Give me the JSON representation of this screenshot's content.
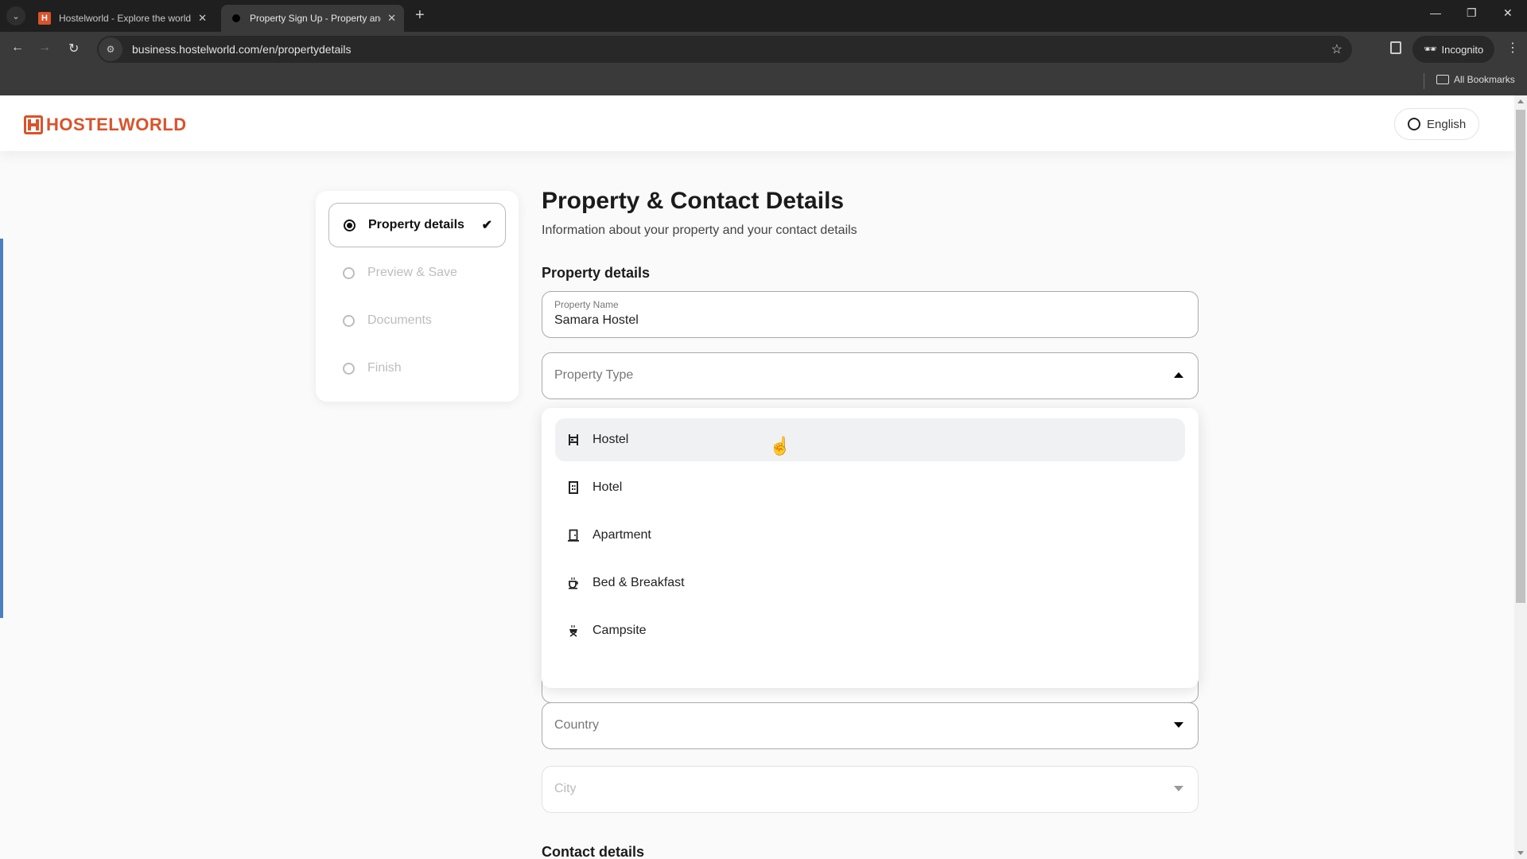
{
  "browser": {
    "tabs": [
      {
        "title": "Hostelworld - Explore the world",
        "active": false
      },
      {
        "title": "Property Sign Up - Property and",
        "active": true
      }
    ],
    "url": "business.hostelworld.com/en/propertydetails",
    "incognito_label": "Incognito",
    "bookmarks_label": "All Bookmarks"
  },
  "header": {
    "logo_text": "HOSTELWORLD",
    "language": "English"
  },
  "colors": {
    "brand": "#d9532b",
    "accent_bar": "#4a7fc1"
  },
  "steps": [
    {
      "label": "Property details",
      "active": true,
      "completed": true
    },
    {
      "label": "Preview & Save",
      "active": false,
      "completed": false
    },
    {
      "label": "Documents",
      "active": false,
      "completed": false
    },
    {
      "label": "Finish",
      "active": false,
      "completed": false
    }
  ],
  "main": {
    "title": "Property & Contact Details",
    "subtitle": "Information about your property and your contact details",
    "property_section": "Property details",
    "contact_section": "Contact details",
    "property_name": {
      "label": "Property Name",
      "value": "Samara Hostel"
    },
    "property_type": {
      "placeholder": "Property Type",
      "expanded": true
    },
    "country": {
      "placeholder": "Country"
    },
    "city": {
      "placeholder": "City",
      "disabled": true
    }
  },
  "property_type_options": [
    {
      "label": "Hostel",
      "icon": "bunk-bed-icon",
      "hovered": true
    },
    {
      "label": "Hotel",
      "icon": "building-icon",
      "hovered": false
    },
    {
      "label": "Apartment",
      "icon": "door-icon",
      "hovered": false
    },
    {
      "label": "Bed & Breakfast",
      "icon": "coffee-cup-icon",
      "hovered": false
    },
    {
      "label": "Campsite",
      "icon": "campfire-grill-icon",
      "hovered": false
    }
  ]
}
